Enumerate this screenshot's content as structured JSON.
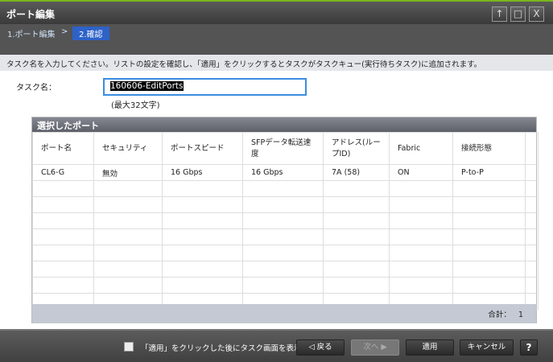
{
  "window": {
    "title": "ポート編集",
    "buttons": [
      "↑",
      "□",
      "X"
    ]
  },
  "breadcrumb": {
    "step1": "1.ポート編集",
    "sep": ">",
    "step2": "2.確認"
  },
  "instruction": "タスク名を入力してください。リストの設定を確認し、「適用」をクリックするとタスクがタスクキュー(実行待ちタスク)に追加されます。",
  "task": {
    "label": "タスク名：",
    "value": "160606-EditPorts",
    "hint": "(最大32文字)"
  },
  "table": {
    "title": "選択したポート",
    "columns": [
      "ポート名",
      "セキュリティ",
      "ポートスピード",
      "SFPデータ転送速度",
      "アドレス(ループID)",
      "Fabric",
      "接続形態"
    ],
    "rows": [
      [
        "CL6-G",
        "無効",
        "16 Gbps",
        "16 Gbps",
        "7A (58)",
        "ON",
        "P-to-P"
      ]
    ],
    "total_label": "合計：",
    "total": "1"
  },
  "footer": {
    "checkbox_label": "「適用」をクリックした後にタスク画面を表示",
    "checkbox_checked": false,
    "back": "◁ 戻る",
    "next": "次へ ▶",
    "apply": "適用",
    "cancel": "キャンセル",
    "help": "?"
  }
}
